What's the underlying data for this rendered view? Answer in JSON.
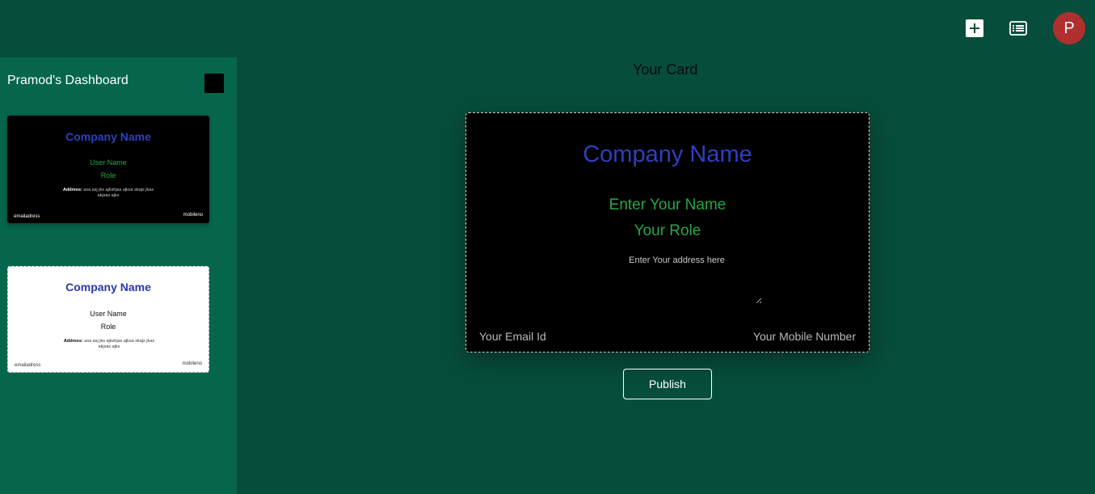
{
  "header": {
    "add_icon": "plus-icon",
    "list_icon": "list-icon",
    "avatar_initial": "P",
    "avatar_color": "#b0302f"
  },
  "sidebar": {
    "title": "Pramod's Dashboard",
    "cards": [
      {
        "theme": "dark",
        "company": "Company Name",
        "user": "User Name",
        "role": "Role",
        "address_label": "Address:",
        "address": "asa asj jks ajkshjas ajksa skajs jkas akjsas ajks",
        "email": "emailadress",
        "mobile": "mobileno"
      },
      {
        "theme": "light",
        "company": "Company Name",
        "user": "User Name",
        "role": "Role",
        "address_label": "Address:",
        "address": "asa asj jks ajkshjas ajksa skajs jkas akjsas ajks",
        "email": "emailadress",
        "mobile": "mobileno"
      }
    ]
  },
  "main": {
    "title": "Your Card",
    "card": {
      "company": "Company Name",
      "name": "Enter Your Name",
      "role": "Your Role",
      "address_placeholder": "Enter Your address here",
      "email": "Your Email Id",
      "mobile": "Your Mobile Number"
    },
    "publish_label": "Publish"
  },
  "colors": {
    "background": "#074d3c",
    "sidebar": "#06664c",
    "company_text": "#2e3fbf",
    "name_text": "#27a744"
  }
}
